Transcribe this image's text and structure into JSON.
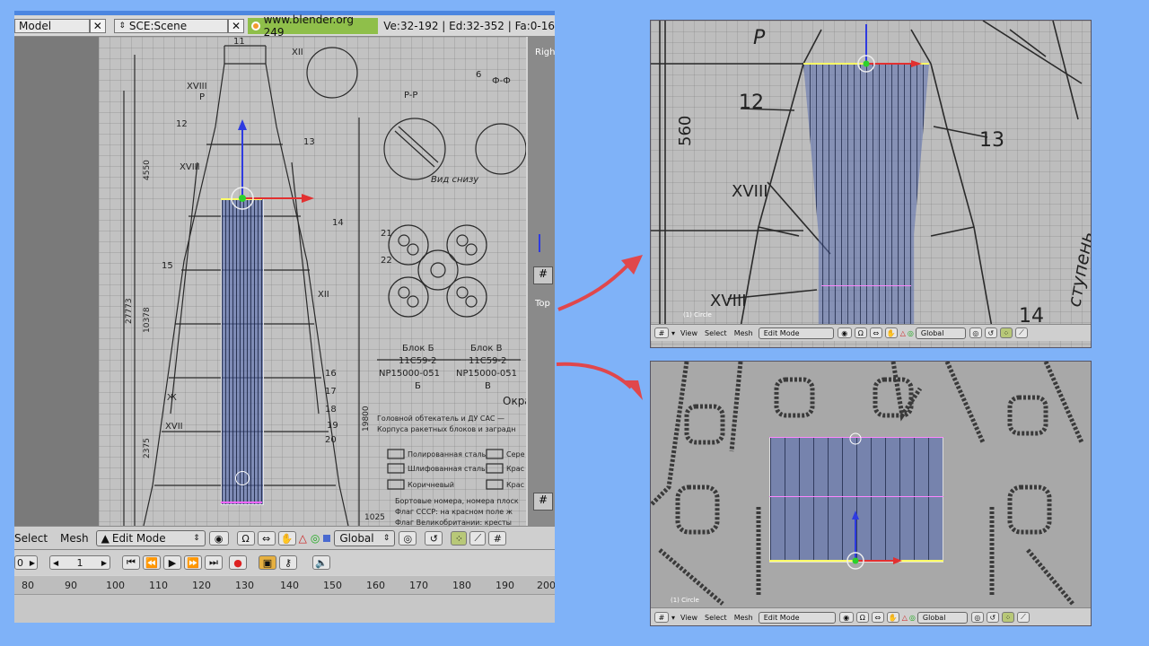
{
  "main_window": {
    "header": {
      "layout_field": "Model",
      "scene_field": "SCE:Scene",
      "url": "www.blender.org 249",
      "stats": "Ve:32-192 | Ed:32-352 | Fa:0-16"
    },
    "side_views": {
      "right_label": "Right",
      "top_label": "Top"
    },
    "toolbar": {
      "select": "Select",
      "mesh": "Mesh",
      "mode": "Edit Mode",
      "orientation": "Global"
    },
    "playback": {
      "start_frame": "0",
      "current_frame": "1"
    },
    "timeline_ticks": [
      "80",
      "90",
      "100",
      "110",
      "120",
      "130",
      "140",
      "150",
      "160",
      "170",
      "180",
      "190",
      "200"
    ]
  },
  "blueprint_labels": {
    "numbers": [
      "11",
      "XII",
      "XVIII",
      "12",
      "13",
      "14",
      "15",
      "16",
      "17",
      "18",
      "19",
      "20",
      "21",
      "22",
      "6",
      "P",
      "P-P",
      "Ф-Ф",
      "XVIII",
      "XII",
      "XVII",
      "Ж"
    ],
    "section_view": "Вид снизу",
    "block_a": "Блок Б",
    "block_b": "Блок В",
    "engine_1": "11С59-2",
    "engine_2": "11С59-2",
    "np_1": "NP15000-051",
    "np_2": "NP15000-051",
    "letter_1": "Б",
    "letter_2": "В",
    "dim_1": "27773",
    "dim_2": "19800",
    "dim_3": "4550",
    "dim_4": "10378",
    "dim_5": "2375",
    "dim_6": "1025",
    "notes": [
      "Головной обтекатель и ДУ САС —",
      "Корпуса ракетных блоков и заградн",
      "Полированная сталь",
      "Шлифованная сталь",
      "Коричневый",
      "Бортовые номера, номера плоск",
      "Флаг СССР: на красном поле ж",
      "Флаг Великобритании: кресты"
    ],
    "legend_right": [
      "Сере",
      "Крас",
      "Крас"
    ],
    "okra": "Окра"
  },
  "top_right_view": {
    "labels": [
      "P",
      "12",
      "560",
      "13",
      "XVIII",
      "XVIII",
      "14",
      "ступень"
    ],
    "object_label": "(1) Circle",
    "toolbar": {
      "view": "View",
      "select": "Select",
      "mesh": "Mesh",
      "mode": "Edit Mode",
      "orientation": "Global"
    }
  },
  "bottom_right_view": {
    "object_label": "(1) Circle",
    "toolbar": {
      "view": "View",
      "select": "Select",
      "mesh": "Mesh",
      "mode": "Edit Mode",
      "orientation": "Global"
    }
  },
  "colors": {
    "background": "#7fb2f8",
    "arrow": "#e0474c",
    "url_bg": "#8fbf4a",
    "mesh_fill": "#6f86c2"
  }
}
